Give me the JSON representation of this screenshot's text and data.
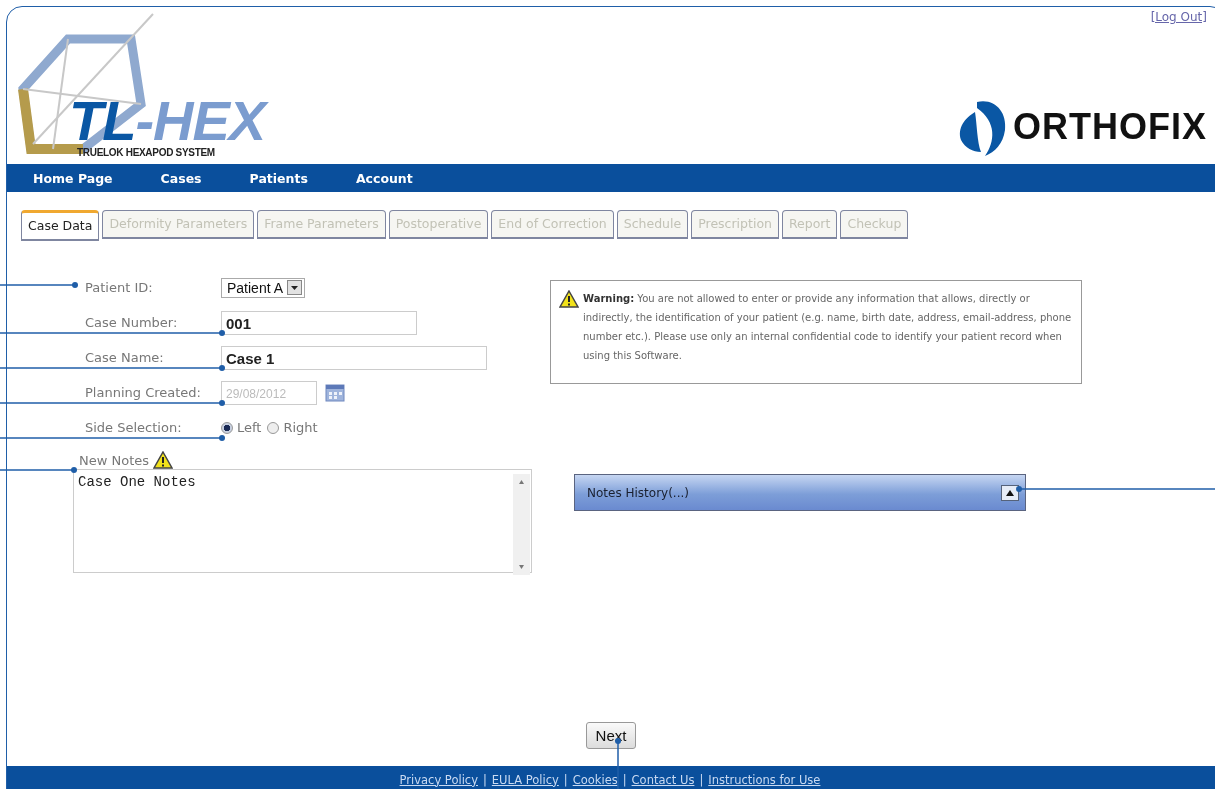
{
  "header": {
    "logout": "[Log Out]",
    "logo_part_1": "TL",
    "logo_part_2": "-HEX",
    "logo_subtitle": "TRUELOK HEXAPOD SYSTEM",
    "brand": "ORTHOFIX"
  },
  "nav": [
    "Home Page",
    "Cases",
    "Patients",
    "Account"
  ],
  "tabs": [
    {
      "label": "Case Data",
      "selected": true,
      "disabled": false
    },
    {
      "label": "Deformity Parameters",
      "selected": false,
      "disabled": true
    },
    {
      "label": "Frame Parameters",
      "selected": false,
      "disabled": true
    },
    {
      "label": "Postoperative",
      "selected": false,
      "disabled": true
    },
    {
      "label": "End of Correction",
      "selected": false,
      "disabled": true
    },
    {
      "label": "Schedule",
      "selected": false,
      "disabled": true
    },
    {
      "label": "Prescription",
      "selected": false,
      "disabled": true
    },
    {
      "label": "Report",
      "selected": false,
      "disabled": true
    },
    {
      "label": "Checkup",
      "selected": false,
      "disabled": true
    }
  ],
  "form": {
    "patient_id": {
      "label": "Patient ID:",
      "value": "Patient A"
    },
    "case_number": {
      "label": "Case Number:",
      "value": "001"
    },
    "case_name": {
      "label": "Case Name:",
      "value": "Case 1"
    },
    "planning_created": {
      "label": "Planning Created:",
      "value": "29/08/2012",
      "disabled": true
    },
    "side_selection": {
      "label": "Side Selection:",
      "options": [
        {
          "label": "Left",
          "selected": true
        },
        {
          "label": "Right",
          "selected": false
        }
      ]
    },
    "new_notes": {
      "label": "New Notes",
      "value": "Case One Notes"
    }
  },
  "warning": {
    "text": "**Warning:** You are not allowed to enter or provide any information that allows, directly or indirectly, the identification of your patient (e.g. name, birth date, address, email-address, phone number etc.). Please use only an internal confidential code to identify your patient record when using this Software."
  },
  "notes_history": {
    "title": "Notes History(...)"
  },
  "next_button": "Next",
  "footer": [
    {
      "kind": "link",
      "text": "Privacy Policy"
    },
    {
      "kind": "separator",
      "text": "|"
    },
    {
      "kind": "link",
      "text": "EULA Policy"
    },
    {
      "kind": "separator",
      "text": "|"
    },
    {
      "kind": "link",
      "text": "Cookies"
    },
    {
      "kind": "separator",
      "text": "|"
    },
    {
      "kind": "link",
      "text": "Contact Us"
    },
    {
      "kind": "separator",
      "text": "|"
    },
    {
      "kind": "link",
      "text": "Instructions for Use"
    }
  ]
}
